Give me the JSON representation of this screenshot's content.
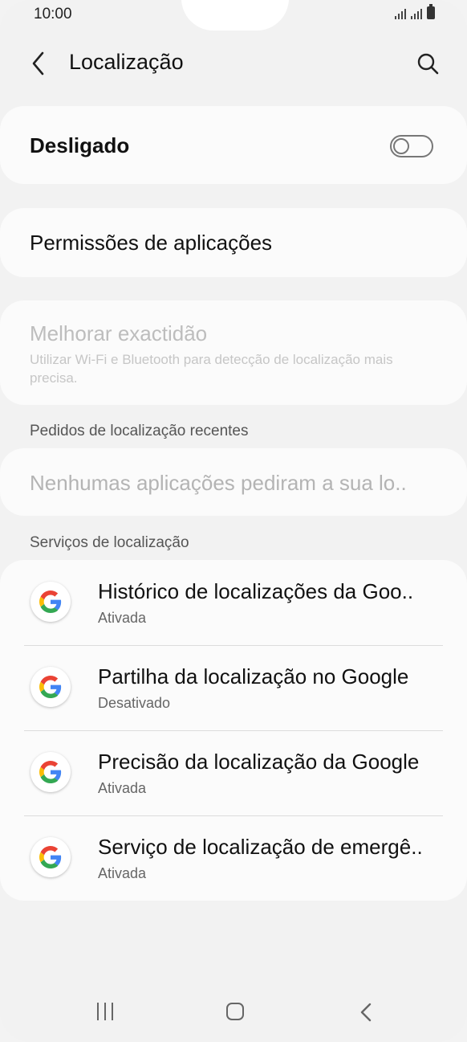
{
  "status": {
    "time": "10:00"
  },
  "header": {
    "title": "Localização"
  },
  "location_toggle": {
    "label": "Desligado",
    "state": "off"
  },
  "app_permissions": {
    "label": "Permissões de aplicações"
  },
  "accuracy": {
    "title": "Melhorar exactidão",
    "subtitle": "Utilizar Wi-Fi e Bluetooth para detecção de localização mais precisa."
  },
  "recent_requests": {
    "section_title": "Pedidos de localização recentes",
    "empty_text": "Nenhumas aplicações pediram a sua lo.."
  },
  "location_services": {
    "section_title": "Serviços de localização",
    "items": [
      {
        "title": "Histórico de localizações da Goo..",
        "status": "Ativada"
      },
      {
        "title": "Partilha da localização no Google",
        "status": "Desativado"
      },
      {
        "title": "Precisão da localização da Google",
        "status": "Ativada"
      },
      {
        "title": "Serviço de localização de emergê..",
        "status": "Ativada"
      }
    ]
  },
  "icons": {
    "back": "back-arrow-icon",
    "search": "search-icon",
    "google": "google-g-icon"
  },
  "colors": {
    "background": "#f2f2f2",
    "card": "#fbfbfb",
    "google_blue": "#4285F4",
    "google_red": "#EA4335",
    "google_yellow": "#FBBC05",
    "google_green": "#34A853"
  }
}
